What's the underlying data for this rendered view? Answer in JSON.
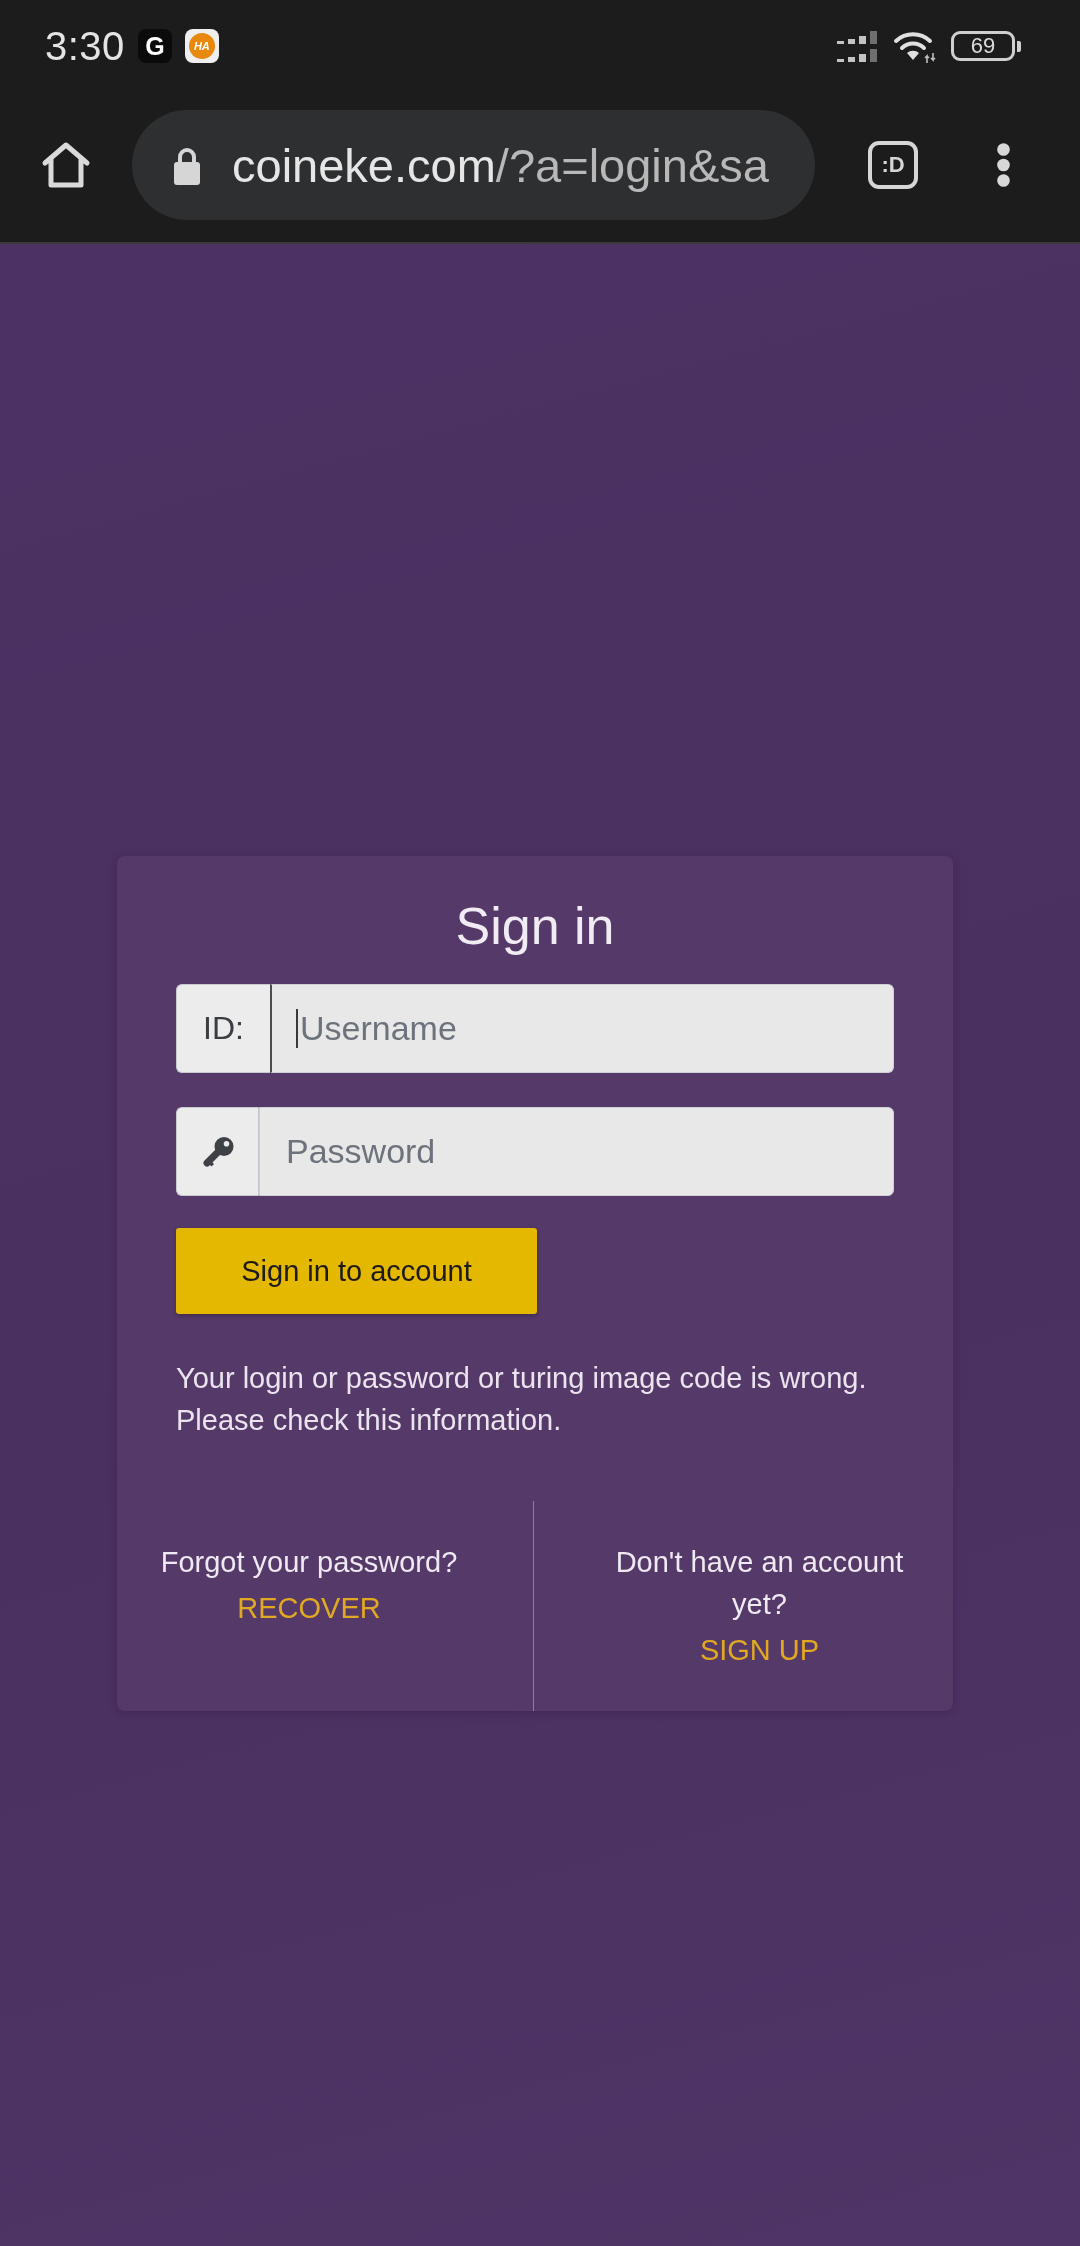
{
  "status_bar": {
    "time": "3:30",
    "notifications": [
      {
        "kind": "dark",
        "glyph": "G"
      },
      {
        "kind": "circled",
        "glyph": "HA"
      }
    ],
    "battery": "69"
  },
  "browser": {
    "url_domain": "coineke.com",
    "url_path": "/?a=login&sa",
    "tab_count": ":D"
  },
  "login_card": {
    "title": "Sign in",
    "fields": [
      {
        "kind": "text",
        "label": "ID:",
        "placeholder": "Username",
        "focused": true
      },
      {
        "kind": "password",
        "placeholder": "Password",
        "focused": false
      }
    ],
    "submit_button": "Sign in to account",
    "error_message": "Your login or password or turing image code is wrong. Please check this information.",
    "footer": [
      {
        "prompt": "Forgot your password?",
        "link": "RECOVER"
      },
      {
        "prompt": "Don't have an account yet?",
        "link": "SIGN UP"
      }
    ]
  }
}
